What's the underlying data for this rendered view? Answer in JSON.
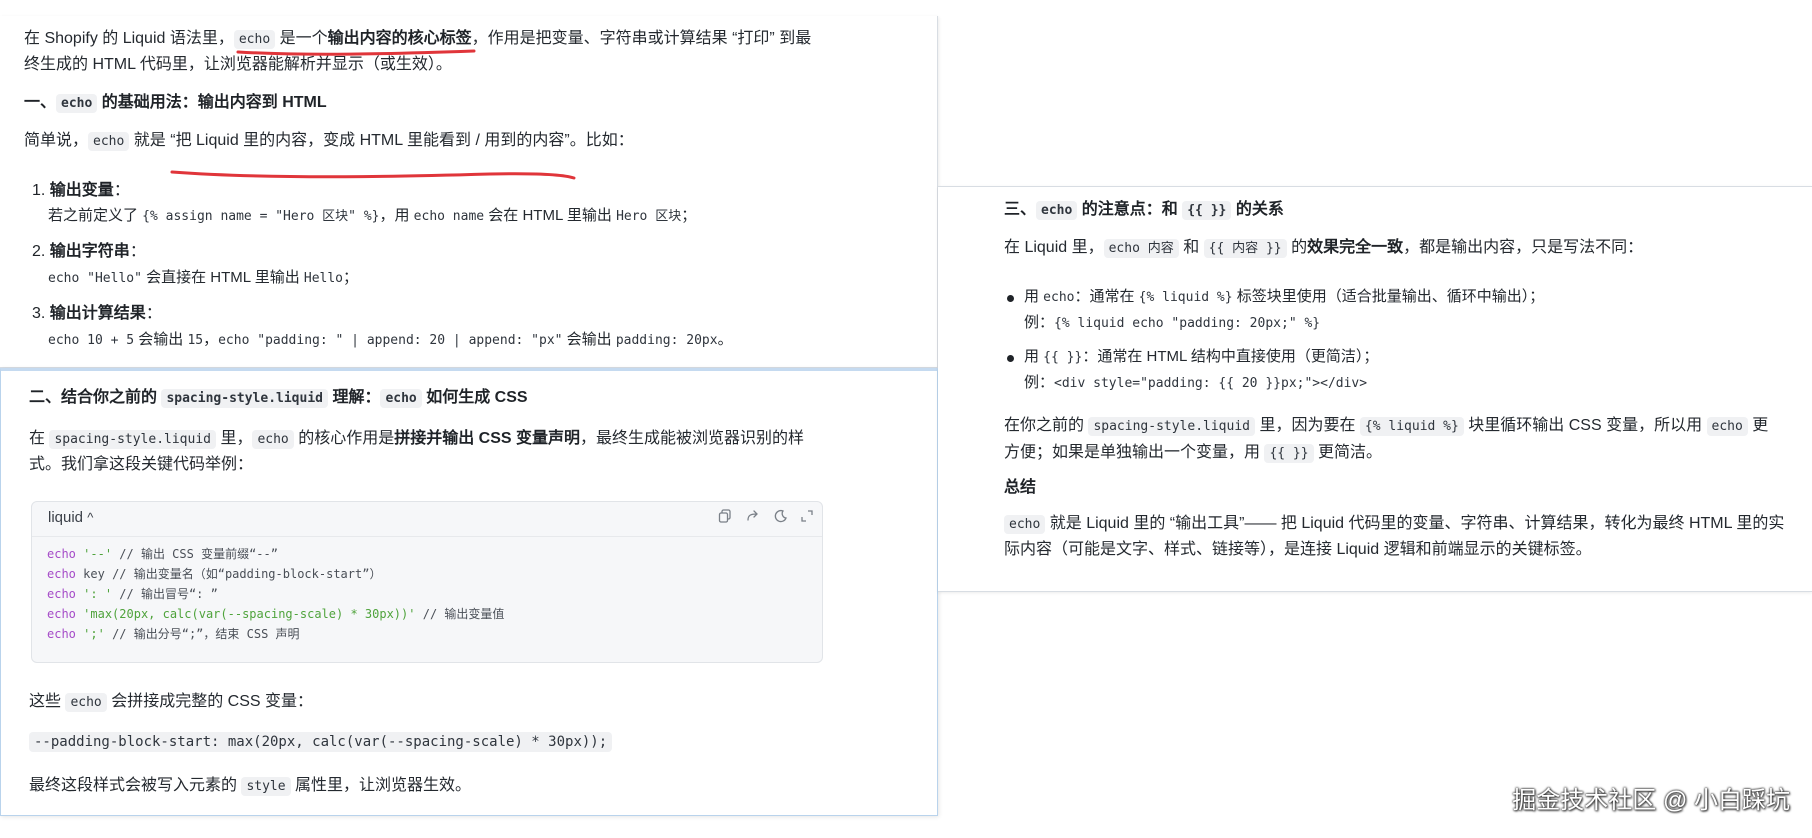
{
  "panel_a": {
    "intro": {
      "part1": "在 Shopify 的 Liquid 语法里，",
      "code": "echo",
      "part2": " 是一个",
      "bold": "输出内容的核心标签",
      "part3": "，作用是把变量、字符串或计算结果 “打印” 到最",
      "line2": "终生成的 HTML 代码里，让浏览器能解析并显示（或生效）。"
    },
    "heading1": {
      "prefix": "一、",
      "code": "echo",
      "suffix": " 的基础用法：输出内容到 HTML"
    },
    "simple": {
      "part1": "简单说，",
      "code": "echo",
      "part2": " 就是 ",
      "quote": "“把 Liquid 里的内容，变成 HTML 里能看到 / 用到的内容”",
      "part3": "。比如："
    },
    "items": [
      {
        "num": "1.",
        "title": "输出变量",
        "colon": "：",
        "line_p1": "若之前定义了 ",
        "line_code1": "{% assign name = \"Hero 区块\" %}",
        "line_p2": "，用 ",
        "line_code2": "echo name",
        "line_p3": " 会在 HTML 里输出 ",
        "line_code3": "Hero 区块",
        "line_p4": "；"
      },
      {
        "num": "2.",
        "title": "输出字符串",
        "colon": "：",
        "line_code1": "echo \"Hello\"",
        "line_p2": " 会直接在 HTML 里输出 ",
        "line_code2": "Hello",
        "line_p3": "；"
      },
      {
        "num": "3.",
        "title": "输出计算结果",
        "colon": "：",
        "line_code1": "echo 10 + 5",
        "line_p2": " 会输出 ",
        "line_code2": "15",
        "line_p3": "，",
        "line_code3": "echo \"padding: \" | append: 20 | append: \"px\"",
        "line_p4": " 会输出 ",
        "line_code4": "padding: 20px",
        "line_p5": "。"
      }
    ]
  },
  "panel_b": {
    "heading": {
      "prefix": "二、结合你之前的 ",
      "code": "spacing-style.liquid",
      "mid": " 理解：",
      "code2": "echo",
      "suffix": " 如何生成 CSS"
    },
    "para": {
      "part1": "在 ",
      "code": "spacing-style.liquid",
      "part2": " 里，",
      "code2": "echo",
      "part3": " 的核心作用是",
      "bold": "拼接并输出 CSS 变量声明",
      "part4": "，最终生成能被浏览器识别的样",
      "line2": "式。我们拿这段关键代码举例："
    },
    "codeblock": {
      "lang": "liquid",
      "caret": "^",
      "icons": [
        "copy-icon",
        "share-icon",
        "theme-icon",
        "expand-icon"
      ],
      "lines": [
        {
          "kw": "echo",
          "str": "'--'",
          "comment": "// 输出 CSS 变量前缀“--”"
        },
        {
          "kw": "echo",
          "str": "key",
          "comment": "// 输出变量名（如“padding-block-start”）"
        },
        {
          "kw": "echo",
          "str": "': '",
          "comment": "// 输出冒号“: ”"
        },
        {
          "kw": "echo",
          "str": "'max(20px, calc(var(--spacing-scale) * 30px))'",
          "comment": "// 输出变量值"
        },
        {
          "kw": "echo",
          "str": "';'",
          "comment": "// 输出分号“;”，结束 CSS 声明"
        }
      ]
    },
    "after": {
      "part1": "这些 ",
      "code": "echo",
      "part2": " 会拼接成完整的 CSS 变量："
    },
    "result_code": "--padding-block-start: max(20px, calc(var(--spacing-scale) * 30px));",
    "final": {
      "part1": "最终这段样式会被写入元素的 ",
      "code": "style",
      "part2": " 属性里，让浏览器生效。"
    }
  },
  "panel_c": {
    "heading": {
      "prefix": "三、",
      "code": "echo",
      "mid": " 的注意点：和 ",
      "code2": "{{ }}",
      "suffix": " 的关系"
    },
    "para": {
      "part1": "在 Liquid 里，",
      "code": "echo 内容",
      "part2": " 和 ",
      "code2": "{{ 内容 }}",
      "part3": " 的",
      "bold": "效果完全一致",
      "part4": "，都是输出内容，只是写法不同："
    },
    "bullets": [
      {
        "p1": "用 ",
        "code": "echo",
        "p2": "：通常在 ",
        "code2": "{% liquid %}",
        "p3": " 标签块里使用（适合批量输出、循环中输出）；",
        "ex_label": "例：",
        "ex_code": "{% liquid echo \"padding: 20px;\" %}"
      },
      {
        "p1": "用 ",
        "code": "{{ }}",
        "p2": "：通常在 HTML 结构中直接使用（更简洁）；",
        "ex_label": "例：",
        "ex_code": "<div style=\"padding: {{ 20 }}px;\"></div>"
      }
    ],
    "note": {
      "part1": "在你之前的 ",
      "code": "spacing-style.liquid",
      "part2": " 里，因为要在 ",
      "code2": "{% liquid %}",
      "part3": " 块里循环输出 CSS 变量，所以用 ",
      "code3": "echo",
      "part4": " 更",
      "line2_p1": "方便；如果是单独输出一个变量，用 ",
      "line2_code": "{{ }}",
      "line2_p2": " 更简洁。"
    },
    "summary_title": "总结",
    "summary": {
      "code": "echo",
      "part1": " 就是 Liquid 里的 “输出工具”—— 把 Liquid 代码里的变量、字符串、计算结果，转化为最终 HTML 里的实",
      "line2": "际内容（可能是文字、样式、链接等），是连接 Liquid 逻辑和前端显示的关键标签。"
    }
  },
  "watermark": "掘金技术社区 @ 小白踩坑",
  "colors": {
    "annotation_red": "#e0353a",
    "keyword_purple": "#a54bc8",
    "string_green": "#4fa33c"
  }
}
